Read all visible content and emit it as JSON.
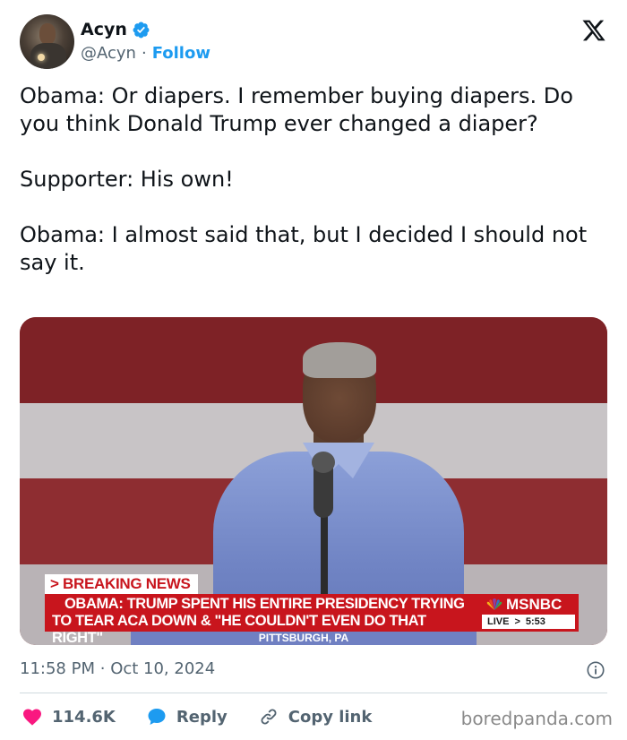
{
  "author": {
    "name": "Acyn",
    "handle": "@Acyn",
    "separator": "·",
    "follow_label": "Follow",
    "verified_color": "#1d9bf0"
  },
  "tweet": {
    "lines": [
      "Obama: Or diapers. I remember buying diapers. Do you think Donald Trump ever changed a diaper?",
      "Supporter: His own!",
      "Obama: I almost said that, but I decided I should not say it."
    ]
  },
  "media": {
    "breaking_label": "> BREAKING NEWS",
    "headline_line1": "OBAMA: TRUMP SPENT HIS ENTIRE PRESIDENCY TRYING",
    "headline_line2": "TO TEAR ACA DOWN & \"HE COULDN'T EVEN DO THAT RIGHT\"",
    "network": "MSNBC",
    "live_label": "LIVE",
    "live_arrow": ">",
    "time": "5:53",
    "location": "PITTSBURGH, PA"
  },
  "meta": {
    "time": "11:58 PM",
    "separator": "·",
    "date": "Oct 10, 2024"
  },
  "actions": {
    "likes": "114.6K",
    "reply_label": "Reply",
    "copy_label": "Copy link"
  },
  "watermark": "boredpanda.com",
  "colors": {
    "accent": "#1d9bf0",
    "like": "#f91880",
    "text": "#0f1419",
    "muted": "#536471",
    "news_red": "#c8151d"
  },
  "icons": {
    "logo": "x-logo-icon",
    "verified": "verified-badge-icon",
    "info": "info-icon",
    "like": "heart-icon",
    "reply": "speech-bubble-icon",
    "copy": "link-icon"
  }
}
